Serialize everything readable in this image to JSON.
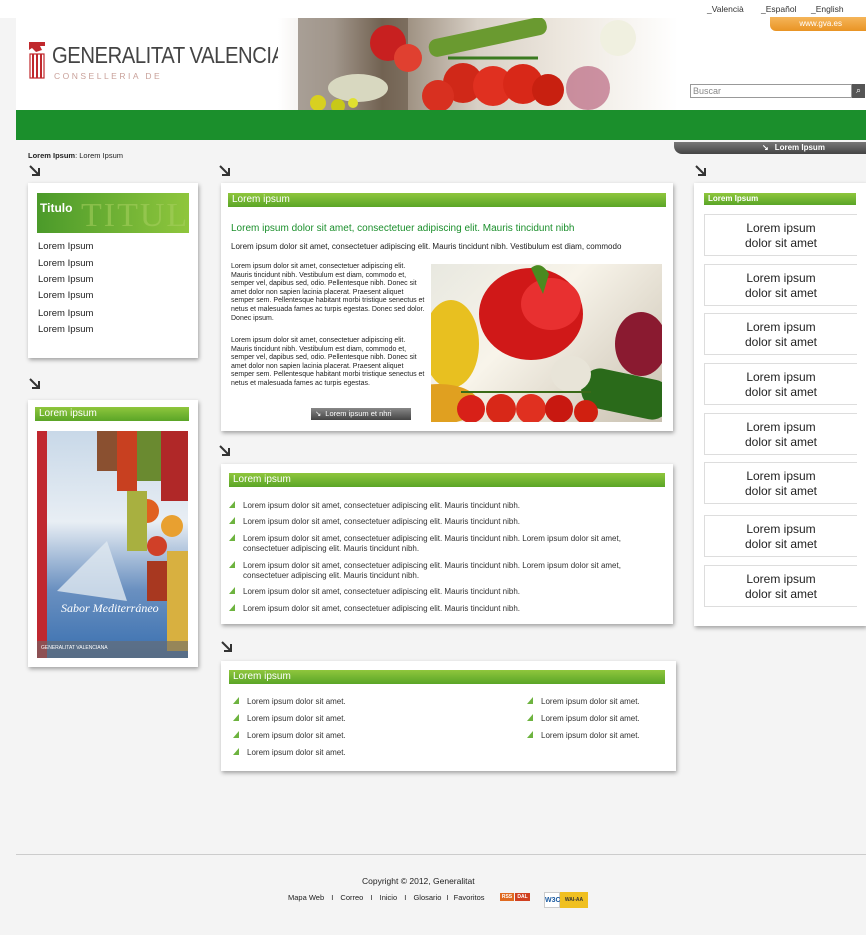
{
  "top": {
    "langs": [
      "_Valencià",
      "_Español",
      "_English"
    ],
    "gva_link": "www.gva.es"
  },
  "header": {
    "title": "GENERALITAT VALENCIANA",
    "subtitle": "CONSELLERIA DE",
    "search_placeholder": "Buscar"
  },
  "breadcrumb": {
    "bold": "Lorem Ipsum",
    "rest": ": Lorem Ipsum"
  },
  "left_menu": {
    "title": "Titulo",
    "watermark": "TITULO",
    "items": [
      "Lorem Ipsum",
      "Lorem Ipsum",
      "Lorem Ipsum",
      "Lorem Ipsum",
      "Lorem Ipsum",
      "Lorem Ipsum"
    ]
  },
  "left_promo": {
    "header": "Lorem ipsum",
    "poster_title": "Sabor Mediterráneo",
    "poster_footer": "GENERALITAT VALENCIANA"
  },
  "main1": {
    "header": "Lorem ipsum",
    "headline": "Lorem ipsum dolor sit amet, consectetuer adipiscing elit. Mauris tincidunt nibh",
    "lead": "Lorem ipsum dolor sit amet, consectetuer adipiscing elit. Mauris tincidunt nibh. Vestibulum est diam, commodo",
    "para1": "Lorem ipsum dolor sit amet, consectetuer adipiscing elit. Mauris tincidunt nibh. Vestibulum est diam, commodo et, semper vel, dapibus sed, odio. Pellentesque nibh. Donec sit amet dolor non sapien lacinia placerat. Praesent aliquet semper sem. Pellentesque habitant morbi tristique senectus et netus et malesuada fames ac turpis egestas. Donec sed dolor. Donec ipsum.",
    "para2": "Lorem ipsum dolor sit amet, consectetuer adipiscing elit. Mauris tincidunt nibh. Vestibulum est diam, commodo et, semper vel, dapibus sed, odio. Pellentesque nibh. Donec sit amet dolor non sapien lacinia placerat. Praesent aliquet semper sem. Pellentesque habitant morbi tristique senectus et netus et malesuada fames ac turpis egestas.",
    "button": "Lorem ipsum et nhri"
  },
  "main2": {
    "header": "Lorem ipsum",
    "items": [
      "Lorem ipsum dolor sit amet, consectetuer adipiscing elit. Mauris tincidunt nibh.",
      "Lorem ipsum dolor sit amet, consectetuer adipiscing elit. Mauris tincidunt nibh.",
      "Lorem ipsum dolor sit amet, consectetuer adipiscing elit. Mauris tincidunt nibh. Lorem ipsum dolor sit amet, consectetuer adipiscing elit. Mauris tincidunt nibh.",
      "Lorem ipsum dolor sit amet, consectetuer adipiscing elit. Mauris tincidunt nibh. Lorem ipsum dolor sit amet, consectetuer adipiscing elit. Mauris tincidunt nibh.",
      "Lorem ipsum dolor sit amet, consectetuer adipiscing elit. Mauris tincidunt nibh.",
      "Lorem ipsum dolor sit amet, consectetuer adipiscing elit. Mauris tincidunt nibh."
    ]
  },
  "main3": {
    "header": "Lorem ipsum",
    "left_items": [
      "Lorem ipsum dolor sit amet.",
      "Lorem ipsum dolor sit amet.",
      "Lorem ipsum dolor sit amet.",
      "Lorem ipsum dolor sit amet."
    ],
    "right_items": [
      "Lorem ipsum dolor sit amet.",
      "Lorem ipsum dolor sit amet.",
      "Lorem ipsum dolor sit amet."
    ]
  },
  "right": {
    "tab": "Lorem Ipsum",
    "header": "Lorem Ipsum",
    "cards": [
      {
        "l1": "Lorem ipsum",
        "l2": "dolor sit amet"
      },
      {
        "l1": "Lorem ipsum",
        "l2": "dolor sit amet"
      },
      {
        "l1": "Lorem ipsum",
        "l2": "dolor sit amet"
      },
      {
        "l1": "Lorem ipsum",
        "l2": "dolor sit amet"
      },
      {
        "l1": "Lorem ipsum",
        "l2": "dolor sit amet"
      },
      {
        "l1": "Lorem ipsum",
        "l2": "dolor sit amet"
      },
      {
        "l1": "Lorem ipsum",
        "l2": "dolor sit amet"
      },
      {
        "l1": "Lorem ipsum",
        "l2": "dolor sit amet"
      }
    ]
  },
  "footer": {
    "copyright": "Copyright © 2012, Generalitat",
    "links": [
      "Mapa Web",
      "Correo",
      "Inicio",
      "Glosario",
      "Favoritos"
    ],
    "separator": "I",
    "badges": [
      "RSS",
      "DAL",
      "W3C",
      "WAI-AA"
    ]
  },
  "colors": {
    "green": "#1b8f2c",
    "light_green": "#8fc63d",
    "orange": "#e99424"
  }
}
